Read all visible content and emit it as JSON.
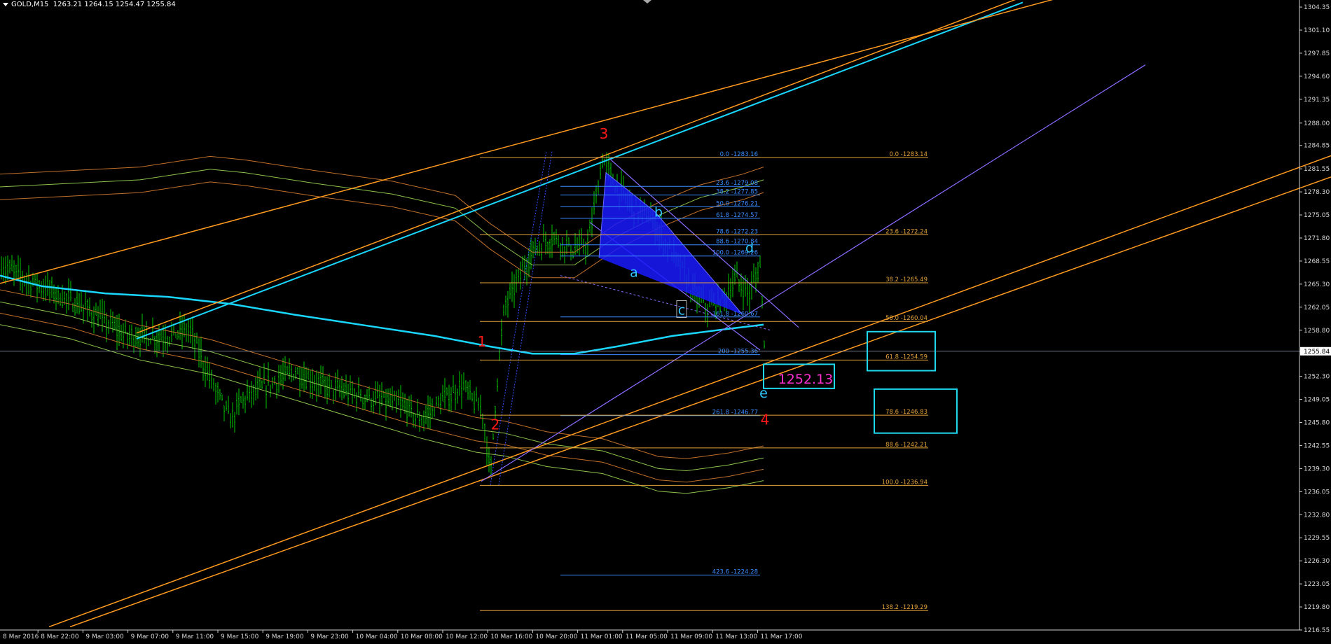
{
  "header": {
    "symbol": "GOLD,M15",
    "ohlc": "1263.21 1264.15 1254.47 1255.84"
  },
  "colors": {
    "background": "#000000",
    "candle": "#00c800",
    "orange_line": "#ff9a1f",
    "purple_line": "#8c6cff",
    "blue_line": "#1ad7ff",
    "fib_blue": "#3a8cff",
    "fib_orange": "#e3a23a",
    "red_label": "#ff1a1a",
    "cyan_label": "#2fc8ff",
    "box": "#1fd7ee",
    "price_box_text": "#ff2fd2"
  },
  "chart_data": {
    "type": "candlestick",
    "ylim": [
      1216.55,
      1304.95
    ],
    "price_labels": [
      "1304.35",
      "1301.10",
      "1297.85",
      "1294.60",
      "1291.35",
      "1288.00",
      "1284.85",
      "1281.55",
      "1278.30",
      "1275.05",
      "1271.80",
      "1268.55",
      "1265.30",
      "1262.05",
      "1258.80",
      "1255.84",
      "1252.30",
      "1249.05",
      "1245.80",
      "1242.55",
      "1239.30",
      "1236.05",
      "1232.80",
      "1229.55",
      "1226.30",
      "1223.05",
      "1219.80",
      "1216.55"
    ],
    "current_price": 1255.84,
    "time_labels": [
      "8 Mar 2016",
      "8 Mar 22:00",
      "9 Mar 03:00",
      "9 Mar 07:00",
      "9 Mar 11:00",
      "9 Mar 15:00",
      "9 Mar 19:00",
      "9 Mar 23:00",
      "10 Mar 04:00",
      "10 Mar 08:00",
      "10 Mar 12:00",
      "10 Mar 16:00",
      "10 Mar 20:00",
      "11 Mar 01:00",
      "11 Mar 05:00",
      "11 Mar 09:00",
      "11 Mar 13:00",
      "11 Mar 17:00"
    ],
    "fib_blue": [
      {
        "label": "0.0 -1283.16",
        "price": 1283.16
      },
      {
        "label": "23.6 -1279.08",
        "price": 1279.08
      },
      {
        "label": "38.2 -1277.85",
        "price": 1277.85
      },
      {
        "label": "50.0 -1276.21",
        "price": 1276.21
      },
      {
        "label": "61.8 -1274.57",
        "price": 1274.57
      },
      {
        "label": "78.6 -1272.23",
        "price": 1272.23
      },
      {
        "label": "88.6 -1270.84",
        "price": 1270.84
      },
      {
        "label": "100.0 -1269.26",
        "price": 1269.26
      },
      {
        "label": "161.8 -1260.67",
        "price": 1260.67
      },
      {
        "label": "200 -1255.36",
        "price": 1255.36
      },
      {
        "label": "261.8 -1246.77",
        "price": 1246.77
      },
      {
        "label": "423.6 -1224.28",
        "price": 1224.28
      }
    ],
    "fib_orange": [
      {
        "label": "0.0 -1283.14",
        "price": 1283.14
      },
      {
        "label": "23.6 -1272.24",
        "price": 1272.24
      },
      {
        "label": "38.2 -1265.49",
        "price": 1265.49
      },
      {
        "label": "50.0 -1260.04",
        "price": 1260.04
      },
      {
        "label": "61.8 -1254.59",
        "price": 1254.59
      },
      {
        "label": "78.6 -1246.83",
        "price": 1246.83
      },
      {
        "label": "88.6 -1242.21",
        "price": 1242.21
      },
      {
        "label": "100.0 -1236.94",
        "price": 1236.94
      },
      {
        "label": "138.2 -1219.29",
        "price": 1219.29
      }
    ],
    "wave_labels": [
      {
        "text": "1",
        "color": "red"
      },
      {
        "text": "2",
        "color": "red"
      },
      {
        "text": "3",
        "color": "red"
      },
      {
        "text": "4",
        "color": "red"
      },
      {
        "text": "a",
        "color": "cyan"
      },
      {
        "text": "b",
        "color": "cyan"
      },
      {
        "text": "c",
        "color": "cyan"
      },
      {
        "text": "d",
        "color": "cyan"
      },
      {
        "text": "e",
        "color": "cyan"
      }
    ],
    "target_box_label": "1252.13"
  }
}
